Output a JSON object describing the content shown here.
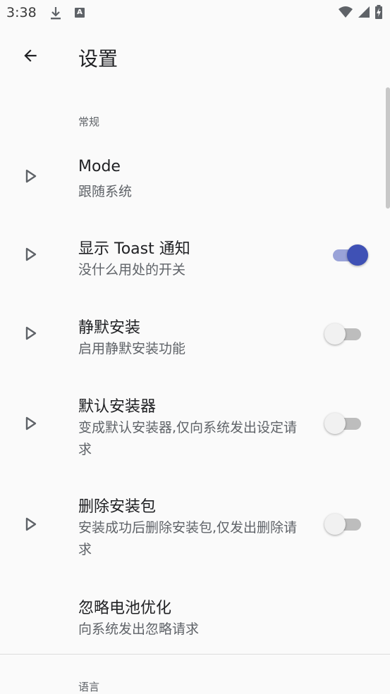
{
  "status_bar": {
    "time": "3:38",
    "notif_letter": "A"
  },
  "app_bar": {
    "title": "设置"
  },
  "sections": [
    {
      "title": "常规"
    },
    {
      "title": "语言"
    }
  ],
  "prefs": [
    {
      "title": "Mode",
      "summary": "跟随系统"
    },
    {
      "title": "显示 Toast 通知",
      "summary": "没什么用处的开关",
      "switch_on": true
    },
    {
      "title": "静默安装",
      "summary": "启用静默安装功能",
      "switch_on": false
    },
    {
      "title": "默认安装器",
      "summary": "变成默认安装器,仅向系统发出设定请求",
      "switch_on": false
    },
    {
      "title": "删除安装包",
      "summary": "安装成功后删除安装包,仅发出删除请求",
      "switch_on": false
    },
    {
      "title": "忽略电池优化",
      "summary": "向系统发出忽略请求"
    }
  ],
  "colors": {
    "accent": "#3f51b5",
    "accent_track": "#9aa3d8",
    "background": "#fafafa",
    "title_text": "#202124",
    "summary_text": "#5f6368"
  },
  "icons": {
    "back": "arrow-back-icon",
    "row": "play-arrow-icon"
  }
}
